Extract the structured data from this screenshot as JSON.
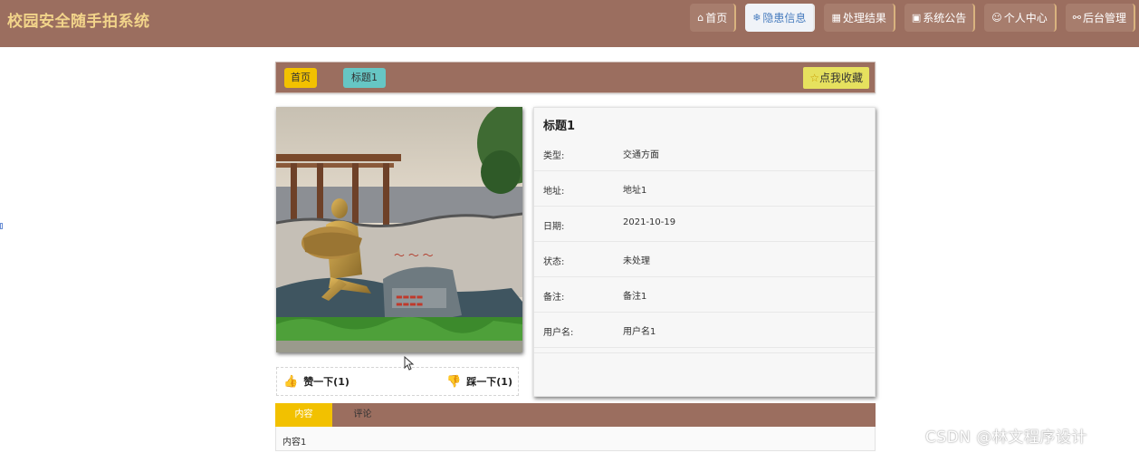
{
  "header": {
    "site_title": "校园安全随手拍系统",
    "nav": [
      {
        "icon": "home-icon",
        "glyph": "⌂",
        "label": "首页"
      },
      {
        "icon": "snowflake-icon",
        "glyph": "❄",
        "label": "隐患信息"
      },
      {
        "icon": "grid-icon",
        "glyph": "▦",
        "label": "处理结果"
      },
      {
        "icon": "notice-icon",
        "glyph": "▣",
        "label": "系统公告"
      },
      {
        "icon": "user-icon",
        "glyph": "☺",
        "label": "个人中心"
      },
      {
        "icon": "link-icon",
        "glyph": "⚯",
        "label": "后台管理"
      }
    ]
  },
  "breadcrumb": {
    "home": "首页",
    "title": "标题1"
  },
  "favorite": {
    "icon": "star-icon",
    "label": "点我收藏"
  },
  "likes": {
    "like_label": "赞一下(1)",
    "dislike_label": "踩一下(1)"
  },
  "detail": {
    "title": "标题1",
    "rows": [
      {
        "label": "类型:",
        "value": "交通方面"
      },
      {
        "label": "地址:",
        "value": "地址1"
      },
      {
        "label": "日期:",
        "value": "2021-10-19"
      },
      {
        "label": "状态:",
        "value": "未处理"
      },
      {
        "label": "备注:",
        "value": "备注1"
      },
      {
        "label": "用户名:",
        "value": "用户名1"
      }
    ]
  },
  "tabs": {
    "content": "内容",
    "comments": "评论"
  },
  "content_text": "内容1",
  "watermark": "CSDN @林文程序设计",
  "colors": {
    "header": "#9b6e5f",
    "accent_yellow": "#f2c100",
    "teal": "#66c6c4"
  }
}
